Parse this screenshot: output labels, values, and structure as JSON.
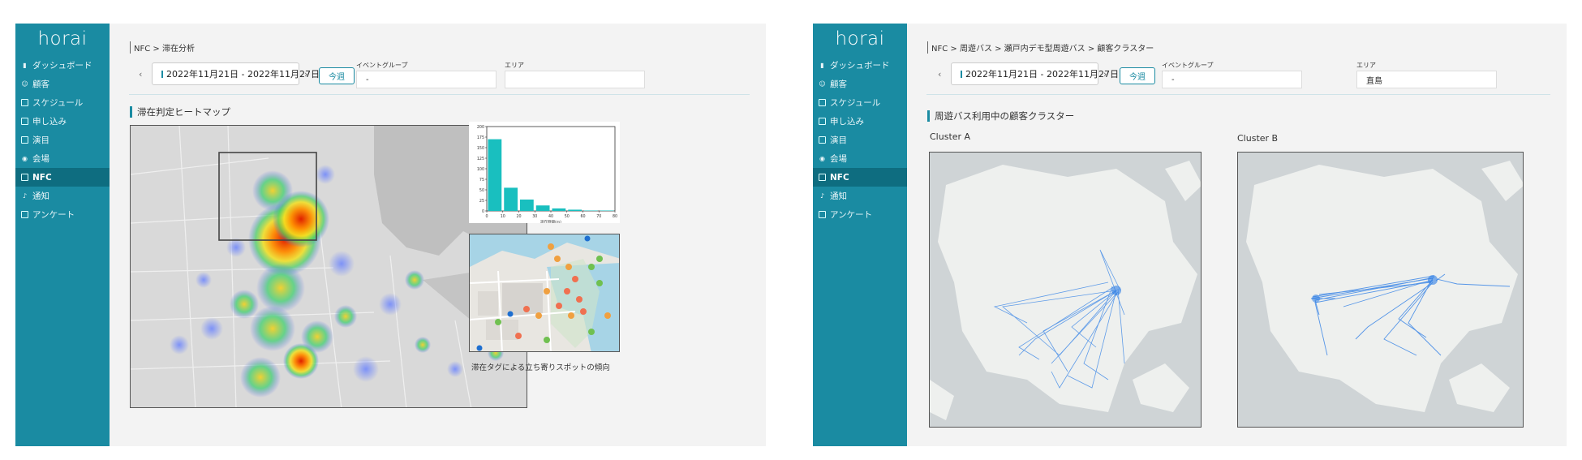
{
  "app": {
    "logo": "horai"
  },
  "sidebar": {
    "items": [
      {
        "label": "ダッシュボード",
        "icon": "bar-chart-icon"
      },
      {
        "label": "顧客",
        "icon": "person-icon"
      },
      {
        "label": "スケジュール",
        "icon": "calendar-icon"
      },
      {
        "label": "申し込み",
        "icon": "form-icon"
      },
      {
        "label": "演目",
        "icon": "ticket-icon"
      },
      {
        "label": "会場",
        "icon": "location-pin-icon"
      },
      {
        "label": "NFC",
        "icon": "phone-icon",
        "active": true
      },
      {
        "label": "通知",
        "icon": "bell-icon"
      },
      {
        "label": "アンケート",
        "icon": "chat-icon"
      }
    ]
  },
  "screen1": {
    "breadcrumb": "NFC  >  滞在分析",
    "date_range": "2022年11月21日 - 2022年11月27日",
    "this_week": "今週",
    "event_group_label": "イベントグループ",
    "event_group_value": "-",
    "area_label": "エリア",
    "area_value": "",
    "section_title": "滞在判定ヒートマップ",
    "spots_caption": "滞在タグによる立ち寄りスポットの傾向",
    "chart_data": {
      "type": "bar",
      "categories": [
        "0",
        "10",
        "20",
        "30",
        "40",
        "50",
        "60",
        "70"
      ],
      "values": [
        170,
        55,
        27,
        13,
        6,
        3,
        1,
        1
      ],
      "xlabel": "滞在時間(m)",
      "ylabel": "",
      "ylim": [
        0,
        200
      ],
      "yticks": [
        "0",
        "25",
        "50",
        "75",
        "100",
        "125",
        "150",
        "175",
        "200"
      ],
      "xticks": [
        "0",
        "10",
        "20",
        "30",
        "40",
        "50",
        "60",
        "70",
        "80"
      ],
      "bar_color": "#19bfbf"
    }
  },
  "screen2": {
    "breadcrumb": "NFC > 周遊バス > 瀬戸内デモ型周遊バス >  顧客クラスター",
    "date_range": "2022年11月21日 - 2022年11月27日",
    "this_week": "今週",
    "event_group_label": "イベントグループ",
    "event_group_value": "-",
    "area_label": "エリア",
    "area_value": "直島",
    "section_title": "周遊バス利用中の顧客クラスター",
    "cluster_a": "Cluster A",
    "cluster_b": "Cluster B"
  },
  "colors": {
    "sidebar": "#1a8ba2",
    "sidebar_active": "#0e6d80",
    "route_line": "#2f7fe6"
  }
}
